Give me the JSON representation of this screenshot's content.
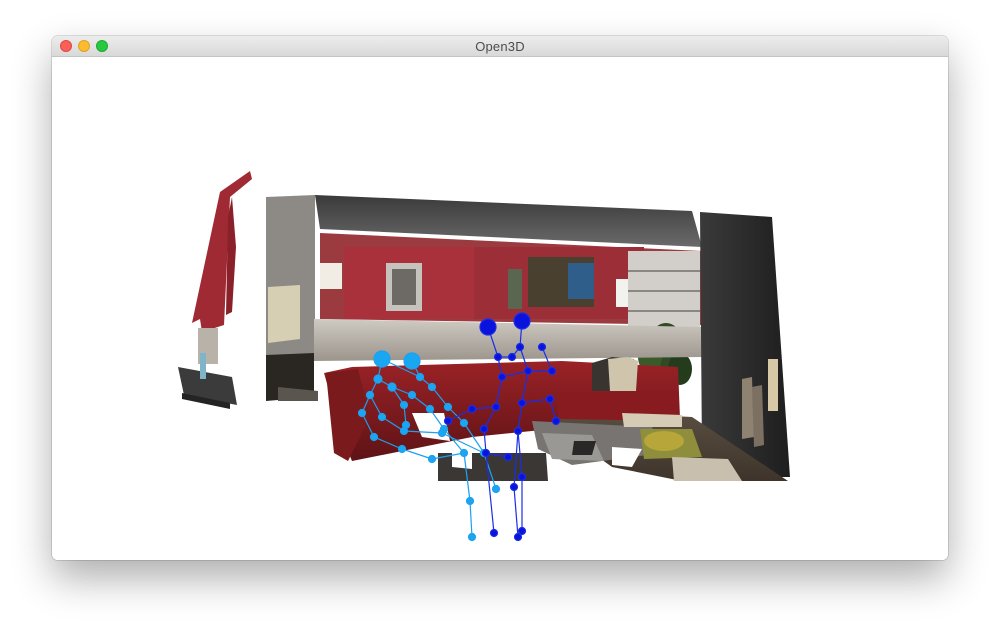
{
  "window": {
    "title": "Open3D",
    "controls": {
      "close": "close-button",
      "minimize": "minimize-button",
      "maximize": "maximize-button"
    }
  },
  "scene": {
    "description_icon": "point-cloud-room",
    "skeletons": [
      {
        "name": "skeleton-left",
        "color": "#1ea0f0"
      },
      {
        "name": "skeleton-right",
        "color": "#1010e0"
      }
    ]
  },
  "colors": {
    "wall_red": "#a52a33",
    "sofa": "#8e1f22",
    "dark_wall": "#2b2b2b",
    "skeleton_light": "#19a7f2",
    "skeleton_dark": "#0a12dd"
  }
}
